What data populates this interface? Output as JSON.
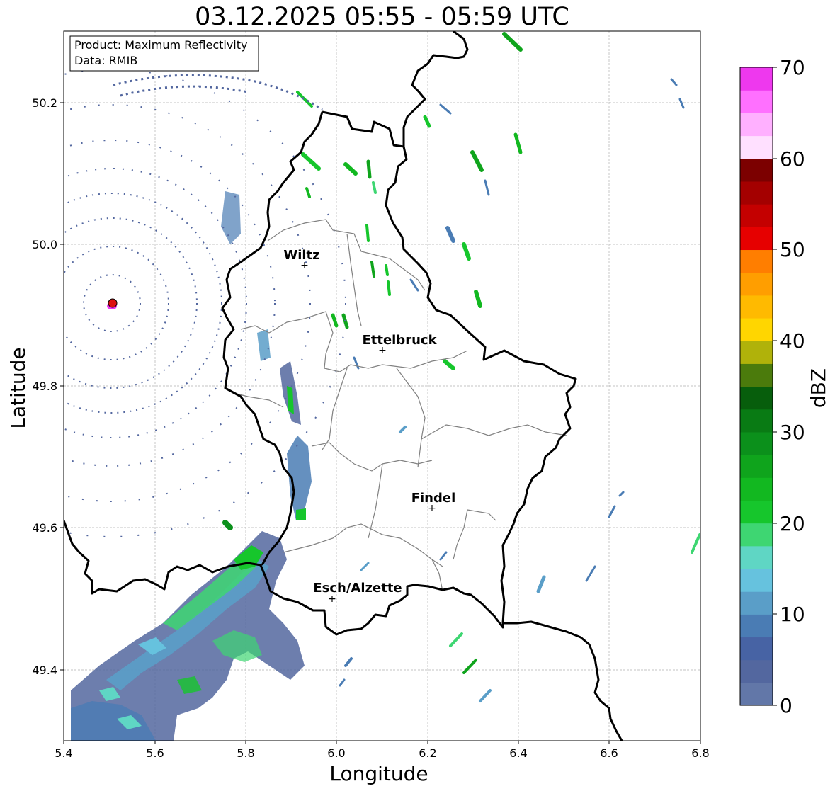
{
  "title": "03.12.2025 05:55 - 05:59 UTC",
  "info": {
    "line1": "Product: Maximum Reflectivity",
    "line2": "Data: RMIB"
  },
  "axes": {
    "xlabel": "Longitude",
    "ylabel": "Latitude",
    "xlim": [
      5.4,
      6.8
    ],
    "ylim": [
      49.3,
      50.3
    ],
    "xticks": [
      "5.4",
      "5.6",
      "5.8",
      "6.0",
      "6.2",
      "6.4",
      "6.6",
      "6.8"
    ],
    "yticks": [
      "49.4",
      "49.6",
      "49.8",
      "50.0",
      "50.2"
    ],
    "grid": true
  },
  "cities": [
    {
      "name": "Wiltz",
      "lon": 5.93,
      "lat": 49.97
    },
    {
      "name": "Ettelbruck",
      "lon": 6.1,
      "lat": 49.85
    },
    {
      "name": "Findel",
      "lon": 6.21,
      "lat": 49.63
    },
    {
      "name": "Esch/Alzette",
      "lon": 5.99,
      "lat": 49.5
    }
  ],
  "radar_site": {
    "lon": 5.505,
    "lat": 49.915,
    "color": "#dd1111"
  },
  "colorbar": {
    "label": "dBZ",
    "ticks": [
      "0",
      "10",
      "20",
      "30",
      "40",
      "50",
      "60",
      "70"
    ],
    "colors": [
      "#6277a8",
      "#53679f",
      "#4763a4",
      "#4a7cb4",
      "#5a9ec8",
      "#66c2de",
      "#5fd6c4",
      "#3ed672",
      "#16c62c",
      "#12b820",
      "#0fa41c",
      "#0b901b",
      "#097b14",
      "#075e0c",
      "#4b7b0c",
      "#b0b20a",
      "#ffd600",
      "#ffba00",
      "#ff9e00",
      "#ff7e00",
      "#e60000",
      "#c40000",
      "#a40000",
      "#7c0000",
      "#ffe0ff",
      "#ffb0ff",
      "#ff70ff",
      "#ee38ee"
    ]
  },
  "legend_colors": {
    "border": "#000000",
    "subdivision": "#808080",
    "grid": "#b0b0b0"
  }
}
